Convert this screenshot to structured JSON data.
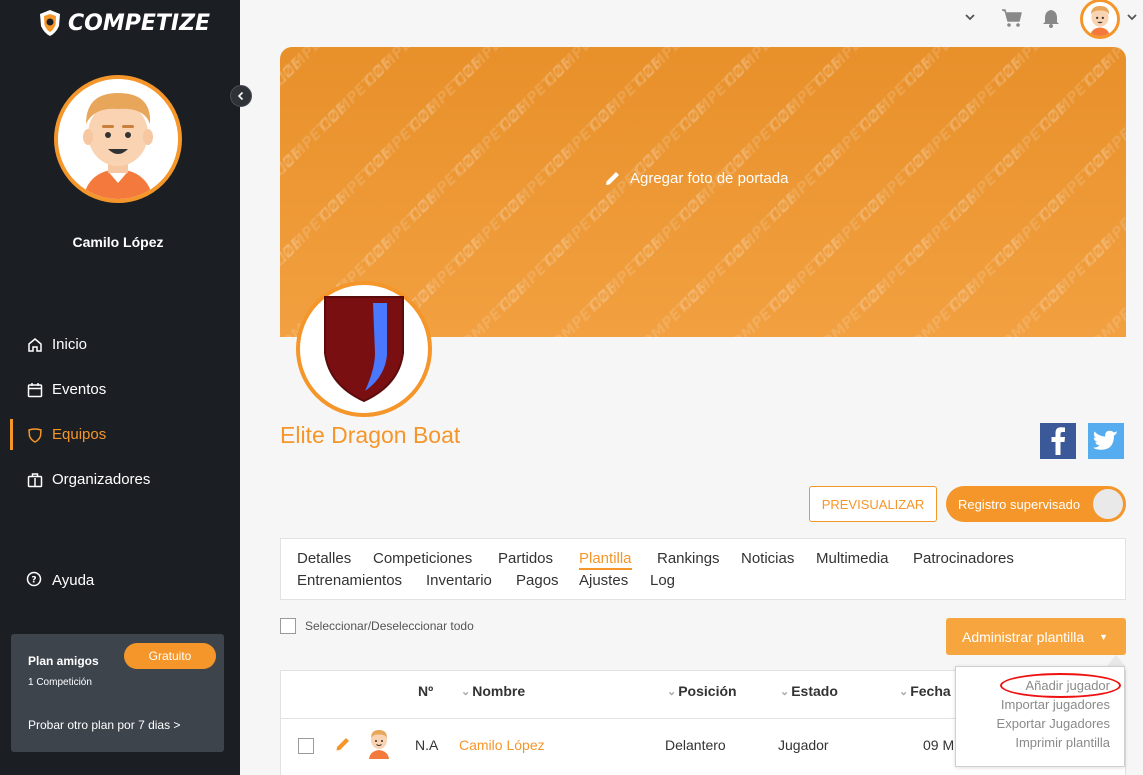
{
  "app": {
    "brand": "COMPETIZE",
    "colors": {
      "accent": "#f5962b",
      "sidebar_bg": "#1b1f23",
      "plan_box": "#3d444c"
    }
  },
  "sidebar": {
    "user_name": "Camilo López",
    "nav": [
      {
        "label": "Inicio",
        "icon": "home-icon"
      },
      {
        "label": "Eventos",
        "icon": "calendar-icon"
      },
      {
        "label": "Equipos",
        "icon": "shield-icon",
        "active": true
      },
      {
        "label": "Organizadores",
        "icon": "briefcase-icon"
      }
    ],
    "help_label": "Ayuda",
    "plan": {
      "title": "Plan amigos",
      "subtitle": "1 Competición",
      "badge": "Gratuito",
      "trial": "Probar otro plan por 7 dias  >"
    }
  },
  "cover": {
    "action_label": "Agregar foto de portada",
    "watermark": "COMPETIZE"
  },
  "team": {
    "name": "Elite Dragon Boat"
  },
  "actions": {
    "preview": "PREVISUALIZAR",
    "supervised": "Registro supervisado"
  },
  "tabs": {
    "row1": [
      "Detalles",
      "Competiciones",
      "Partidos",
      "Plantilla",
      "Rankings",
      "Noticias",
      "Multimedia",
      "Patrocinadores"
    ],
    "row2": [
      "Entrenamientos",
      "Inventario",
      "Pagos",
      "Ajustes",
      "Log"
    ],
    "active": "Plantilla"
  },
  "roster": {
    "select_all": "Seleccionar/Deseleccionar todo",
    "admin_button": "Administrar plantilla",
    "columns": {
      "number": "Nº",
      "name": "Nombre",
      "position": "Posición",
      "status": "Estado",
      "date": "Fecha"
    },
    "rows": [
      {
        "number": "N.A",
        "name": "Camilo López",
        "position": "Delantero",
        "status": "Jugador",
        "date": "09 M"
      }
    ]
  },
  "dropdown": {
    "items": [
      "Añadir jugador",
      "Importar jugadores",
      "Exportar Jugadores",
      "Imprimir plantilla"
    ],
    "highlighted": "Añadir jugador"
  }
}
